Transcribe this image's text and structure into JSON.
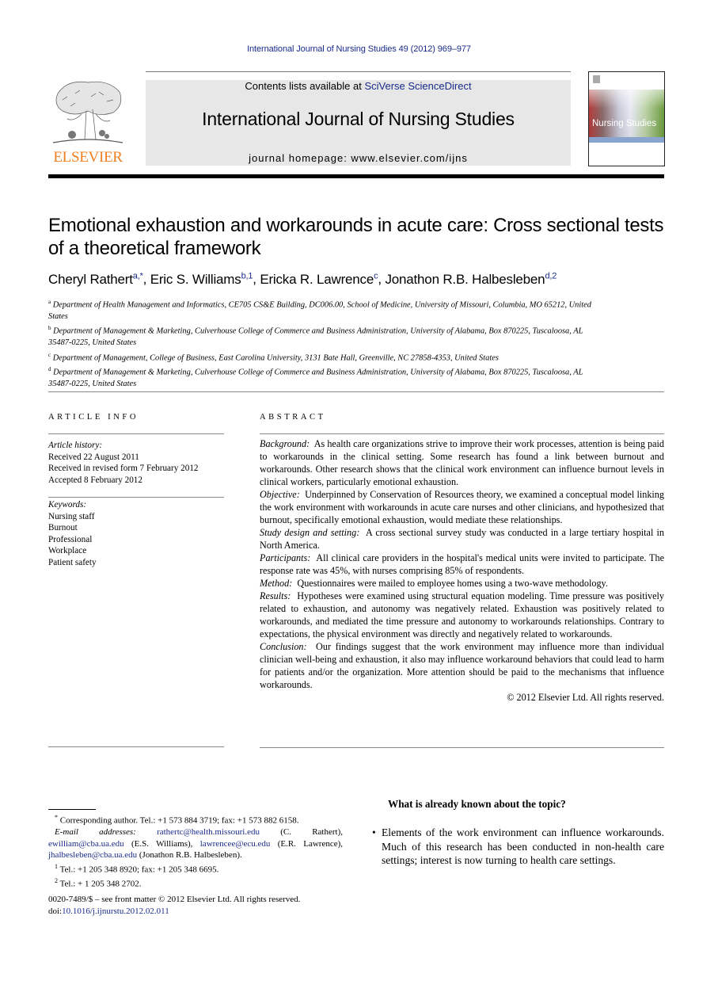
{
  "citation": "International Journal of Nursing Studies 49 (2012) 969–977",
  "header": {
    "publisher_logo_text": "ELSEVIER",
    "contents_prefix": "Contents lists available at ",
    "contents_link": "SciVerse ScienceDirect",
    "journal_title": "International Journal of Nursing Studies",
    "homepage": "journal homepage: www.elsevier.com/ijns",
    "cover_title": "Nursing Studies"
  },
  "article": {
    "title": "Emotional exhaustion and workarounds in acute care: Cross sectional tests of a theoretical framework",
    "authors": [
      {
        "name": "Cheryl Rathert",
        "sup": "a,*",
        "sep": ", "
      },
      {
        "name": "Eric S. Williams",
        "sup": "b,1",
        "sep": ", "
      },
      {
        "name": "Ericka R. Lawrence",
        "sup": "c",
        "sep": ", "
      },
      {
        "name": "Jonathon R.B. Halbesleben",
        "sup": "d,2",
        "sep": ""
      }
    ],
    "affiliations": [
      {
        "sup": "a",
        "text": "Department of Health Management and Informatics, CE705 CS&E Building, DC006.00, School of Medicine, University of Missouri, Columbia, MO 65212, United States"
      },
      {
        "sup": "b",
        "text": "Department of Management & Marketing, Culverhouse College of Commerce and Business Administration, University of Alabama, Box 870225, Tuscaloosa, AL 35487-0225, United States"
      },
      {
        "sup": "c",
        "text": "Department of Management, College of Business, East Carolina University, 3131 Bate Hall, Greenville, NC 27858-4353, United States"
      },
      {
        "sup": "d",
        "text": "Department of Management & Marketing, Culverhouse College of Commerce and Business Administration, University of Alabama, Box 870225, Tuscaloosa, AL 35487-0225, United States"
      }
    ]
  },
  "article_info": {
    "heading": "ARTICLE INFO",
    "history_label": "Article history:",
    "history": [
      "Received 22 August 2011",
      "Received in revised form 7 February 2012",
      "Accepted 8 February 2012"
    ],
    "keywords_label": "Keywords:",
    "keywords": [
      "Nursing staff",
      "Burnout",
      "Professional",
      "Workplace",
      "Patient safety"
    ]
  },
  "abstract": {
    "heading": "ABSTRACT",
    "sections": [
      {
        "label": "Background:",
        "text": "As health care organizations strive to improve their work processes, attention is being paid to workarounds in the clinical setting. Some research has found a link between burnout and workarounds. Other research shows that the clinical work environment can influence burnout levels in clinical workers, particularly emotional exhaustion."
      },
      {
        "label": "Objective:",
        "text": "Underpinned by Conservation of Resources theory, we examined a conceptual model linking the work environment with workarounds in acute care nurses and other clinicians, and hypothesized that burnout, specifically emotional exhaustion, would mediate these relationships."
      },
      {
        "label": "Study design and setting:",
        "text": "A cross sectional survey study was conducted in a large tertiary hospital in North America."
      },
      {
        "label": "Participants:",
        "text": "All clinical care providers in the hospital's medical units were invited to participate. The response rate was 45%, with nurses comprising 85% of respondents."
      },
      {
        "label": "Method:",
        "text": "Questionnaires were mailed to employee homes using a two-wave methodology."
      },
      {
        "label": "Results:",
        "text": "Hypotheses were examined using structural equation modeling. Time pressure was positively related to exhaustion, and autonomy was negatively related. Exhaustion was positively related to workarounds, and mediated the time pressure and autonomy to workarounds relationships. Contrary to expectations, the physical environment was directly and negatively related to workarounds."
      },
      {
        "label": "Conclusion:",
        "text": "Our findings suggest that the work environment may influence more than individual clinician well-being and exhaustion, it also may influence workaround behaviors that could lead to harm for patients and/or the organization. More attention should be paid to the mechanisms that influence workarounds."
      }
    ],
    "copyright": "© 2012 Elsevier Ltd. All rights reserved."
  },
  "footnotes": {
    "corresponding": "Corresponding author. Tel.: +1 573 884 3719; fax: +1 573 882 6158.",
    "corresponding_mark": "*",
    "email_label": "E-mail addresses:",
    "emails": [
      {
        "address": "rathertc@health.missouri.edu",
        "owner": "(C. Rathert),"
      },
      {
        "address": "ewilliam@cba.ua.edu",
        "owner": "(E.S. Williams),"
      },
      {
        "address": "lawrencee@ecu.edu",
        "owner": "(E.R. Lawrence),"
      },
      {
        "address": "jhalbesleben@cba.ua.edu",
        "owner": "(Jonathon R.B. Halbesleben)."
      }
    ],
    "note1_mark": "1",
    "note1": "Tel.: +1 205 348 8920; fax: +1 205 348 6695.",
    "note2_mark": "2",
    "note2": "Tel.: + 1 205 348 2702.",
    "front_matter": "0020-7489/$ – see front matter © 2012 Elsevier Ltd. All rights reserved.",
    "doi_label": "doi:",
    "doi": "10.1016/j.ijnurstu.2012.02.011"
  },
  "known": {
    "heading": "What is already known about the topic?",
    "items": [
      "Elements of the work environment can influence workarounds. Much of this research has been conducted in non-health care settings; interest is now turning to health care settings."
    ]
  }
}
